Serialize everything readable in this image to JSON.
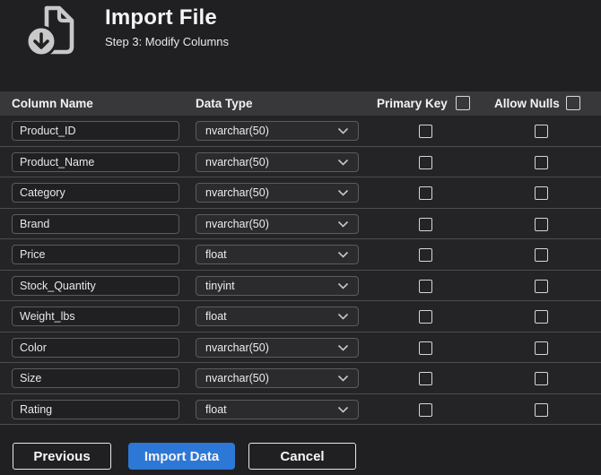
{
  "page": {
    "title": "Import File",
    "subtitle": "Step 3: Modify Columns",
    "icon": "import-file-icon"
  },
  "table": {
    "headers": {
      "column_name": "Column Name",
      "data_type": "Data Type",
      "primary_key": "Primary Key",
      "allow_nulls": "Allow Nulls"
    },
    "select_all": {
      "primary_key_checked": false,
      "allow_nulls_checked": false
    },
    "rows": [
      {
        "name": "Product_ID",
        "type": "nvarchar(50)",
        "primary_key": false,
        "allow_nulls": false
      },
      {
        "name": "Product_Name",
        "type": "nvarchar(50)",
        "primary_key": false,
        "allow_nulls": false
      },
      {
        "name": "Category",
        "type": "nvarchar(50)",
        "primary_key": false,
        "allow_nulls": false
      },
      {
        "name": "Brand",
        "type": "nvarchar(50)",
        "primary_key": false,
        "allow_nulls": false
      },
      {
        "name": "Price",
        "type": "float",
        "primary_key": false,
        "allow_nulls": false
      },
      {
        "name": "Stock_Quantity",
        "type": "tinyint",
        "primary_key": false,
        "allow_nulls": false
      },
      {
        "name": "Weight_lbs",
        "type": "float",
        "primary_key": false,
        "allow_nulls": false
      },
      {
        "name": "Color",
        "type": "nvarchar(50)",
        "primary_key": false,
        "allow_nulls": false
      },
      {
        "name": "Size",
        "type": "nvarchar(50)",
        "primary_key": false,
        "allow_nulls": false
      },
      {
        "name": "Rating",
        "type": "float",
        "primary_key": false,
        "allow_nulls": false
      }
    ]
  },
  "footer": {
    "previous_label": "Previous",
    "import_label": "Import Data",
    "cancel_label": "Cancel"
  },
  "colors": {
    "page_bg": "#202022",
    "table_header_bg": "#38383b",
    "row_bg": "#242427",
    "row_separator": "#4d4d4f",
    "accent_blue": "#2d77d6",
    "icon_gray": "#c9c9c9"
  }
}
